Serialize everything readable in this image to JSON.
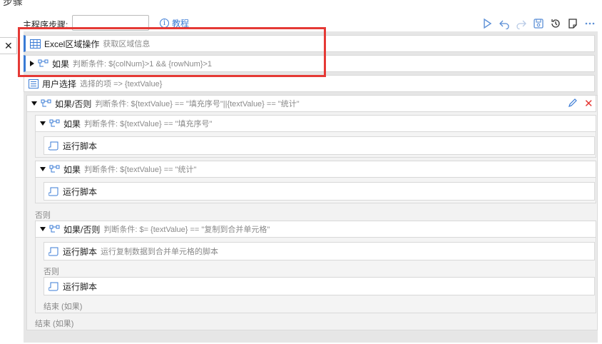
{
  "header": {
    "cut_title": "步骤",
    "step_label": "主程序步骤:",
    "step_value": "",
    "tutorial_label": "教程"
  },
  "toolbar": {
    "icons": [
      "play-icon",
      "undo-icon",
      "redo-icon",
      "save-icon",
      "history-icon",
      "note-icon",
      "more-icon"
    ]
  },
  "steps": {
    "excel": {
      "label": "Excel区域操作",
      "desc": "获取区域信息"
    },
    "if1": {
      "label": "如果",
      "desc": "判断条件: ${colNum}>1 && {rowNum}>1"
    },
    "user": {
      "label": "用户选择",
      "desc": "选择的项 => {textValue}"
    },
    "ifelse1": {
      "label": "如果/否则",
      "desc": "判断条件: ${textValue} == \"填充序号\"||{textValue} == \"统计\""
    },
    "if2": {
      "label": "如果",
      "desc": "判断条件: ${textValue} == \"填充序号\""
    },
    "run1": {
      "label": "运行脚本"
    },
    "if3": {
      "label": "如果",
      "desc": "判断条件: ${textValue} == \"统计\""
    },
    "run2": {
      "label": "运行脚本"
    },
    "else1": "否则",
    "ifelse2": {
      "label": "如果/否则",
      "desc": "判断条件: $= {textValue} == \"复制到合并单元格\""
    },
    "run3": {
      "label": "运行脚本",
      "desc": "运行复制数据到合并单元格的脚本"
    },
    "else2": "否则",
    "run4": {
      "label": "运行脚本"
    },
    "end_inner": "结束 (如果)",
    "end_outer": "结束 (如果)"
  },
  "colors": {
    "accent": "#3a7bd5",
    "highlight": "#e53935",
    "delete": "#e53935"
  }
}
